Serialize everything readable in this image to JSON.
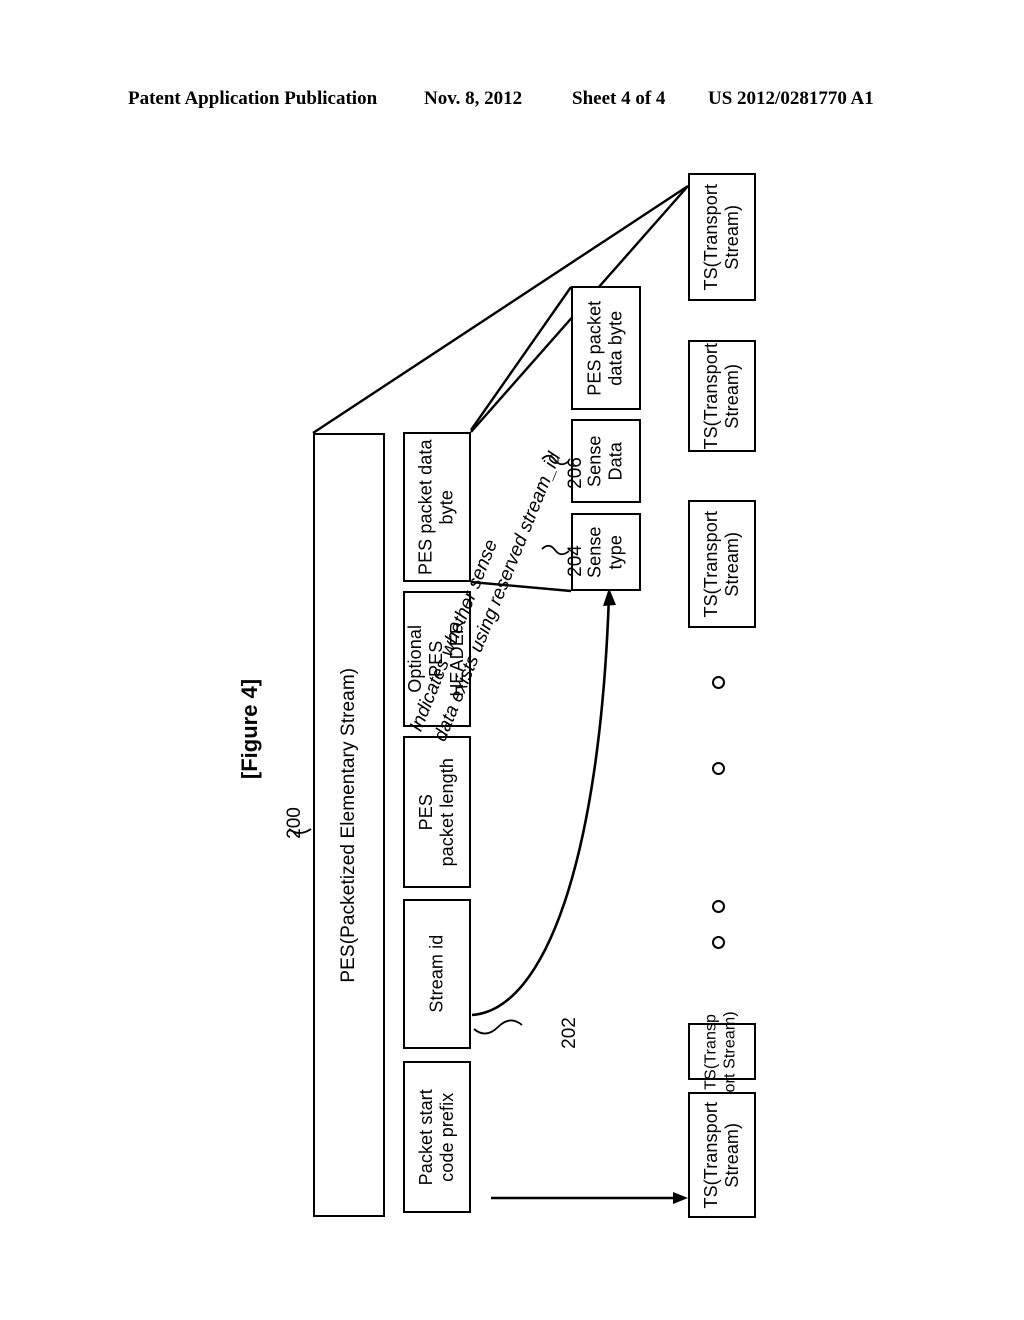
{
  "header": {
    "publication": "Patent Application Publication",
    "date": "Nov. 8, 2012",
    "sheet": "Sheet 4 of 4",
    "patent_number": "US 2012/0281770 A1"
  },
  "figure": {
    "caption": "[Figure 4]",
    "pes_container": {
      "label": "PES(Packetized Elementary Stream)",
      "ref": "200"
    },
    "pes_fields": [
      {
        "name": "packet-start-code-prefix",
        "label": "Packet start\ncode prefix"
      },
      {
        "name": "stream-id",
        "label": "Stream id",
        "ref": "202"
      },
      {
        "name": "pes-packet-length",
        "label": "PES\npacket length"
      },
      {
        "name": "optional-pes-header",
        "label": "Optional\nPES\nHEADER"
      },
      {
        "name": "pes-packet-data-byte",
        "label": "PES packet data\nbyte"
      }
    ],
    "payload_fields": [
      {
        "name": "sense-type",
        "label": "Sense\ntype",
        "ref": "204"
      },
      {
        "name": "sense-data",
        "label": "Sense\nData",
        "ref": "206"
      },
      {
        "name": "pes-packet-data-byte",
        "label": "PES packet\ndata byte"
      }
    ],
    "annotation": "Indicates whether sense\ndata exists using reserved stream_id",
    "transport_stream_boxes": [
      {
        "name": "ts-box-1",
        "label": "TS(Transport\nStream)"
      },
      {
        "name": "ts-box-2",
        "label": "TS(Transport\nStream)"
      },
      {
        "name": "ts-box-3",
        "label": "TS(Transport\nStream)"
      },
      {
        "name": "ts-box-4",
        "label": "TS(Transp\nort Stream)"
      },
      {
        "name": "ts-box-5",
        "label": "TS(Transport\nStream)"
      }
    ],
    "ellipsis_dot_count": 4,
    "colors": {
      "line": "#000000",
      "background": "#ffffff"
    }
  }
}
